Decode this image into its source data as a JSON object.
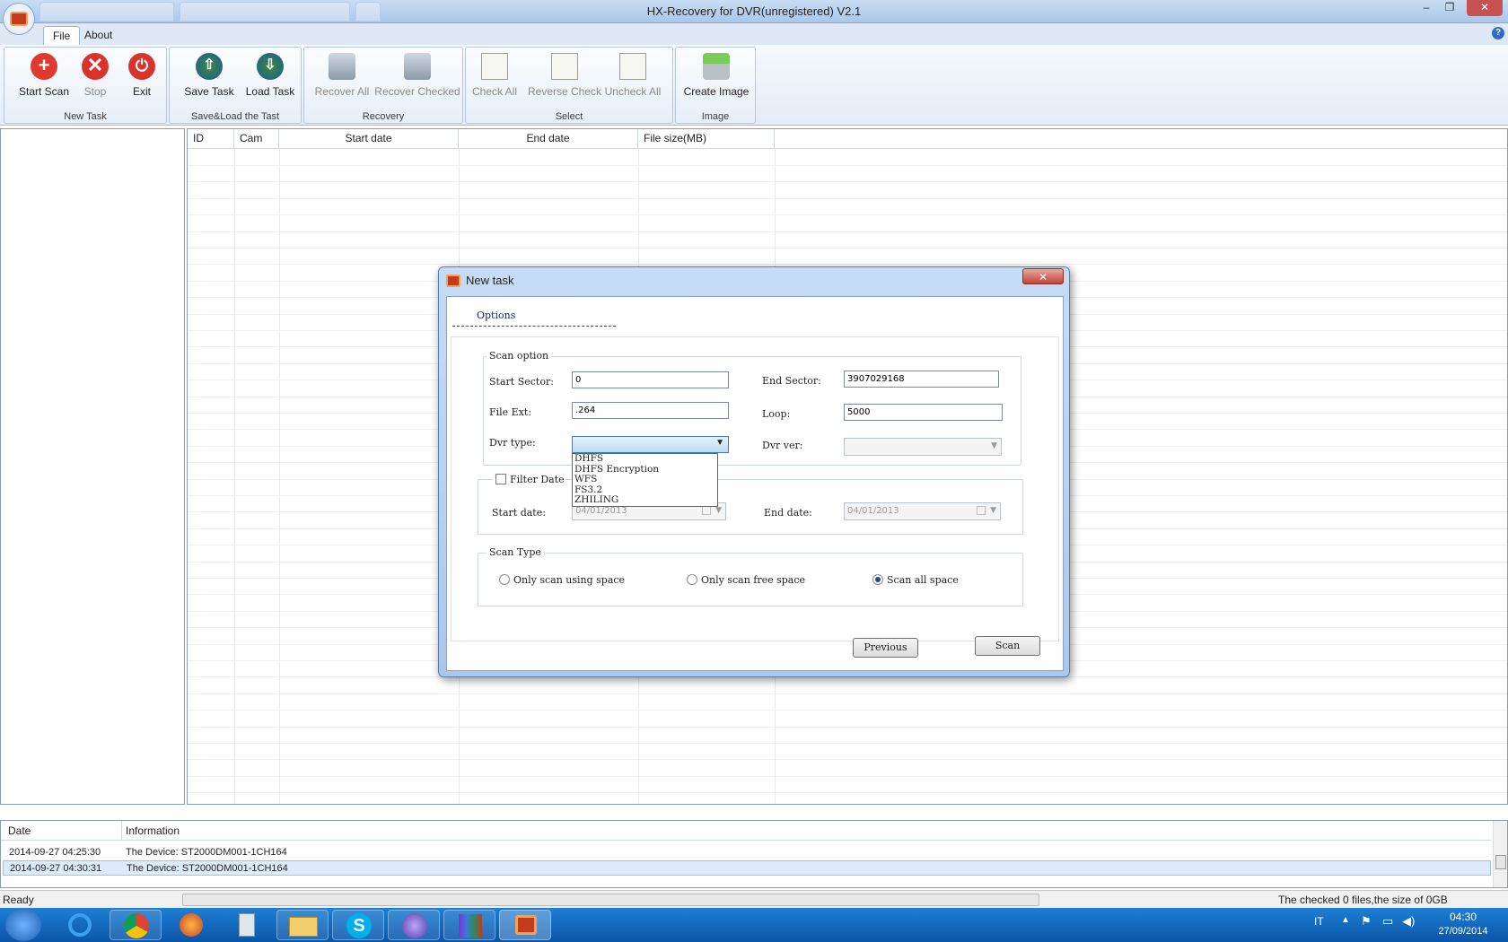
{
  "window": {
    "title": "HX-Recovery for DVR(unregistered) V2.1",
    "min": "–",
    "restore": "❐",
    "close": "✕"
  },
  "ribbon_tabs": [
    {
      "label": "File"
    },
    {
      "label": "About"
    }
  ],
  "help": "?",
  "ribbon": {
    "groups": [
      {
        "label": "New Task",
        "buttons": [
          {
            "label": "Start Scan",
            "icon": "plus-icon"
          },
          {
            "label": "Stop",
            "icon": "x-icon"
          },
          {
            "label": "Exit",
            "icon": "power-icon"
          }
        ]
      },
      {
        "label": "Save&Load the Tast",
        "buttons": [
          {
            "label": "Save Task",
            "icon": "save-icon"
          },
          {
            "label": "Load Task",
            "icon": "load-icon"
          }
        ]
      },
      {
        "label": "Recovery",
        "buttons": [
          {
            "label": "Recover All",
            "icon": "recover-icon"
          },
          {
            "label": "Recover Checked",
            "icon": "recover-checked-icon"
          }
        ]
      },
      {
        "label": "Select",
        "buttons": [
          {
            "label": "Check All",
            "icon": "checklist-icon"
          },
          {
            "label": "Reverse Check",
            "icon": "checklist-icon"
          },
          {
            "label": "Uncheck All",
            "icon": "checklist-icon"
          }
        ]
      },
      {
        "label": "Image",
        "buttons": [
          {
            "label": "Create Image",
            "icon": "disk-image-icon"
          }
        ]
      }
    ]
  },
  "table": {
    "columns": [
      "ID",
      "Cam",
      "Start date",
      "End date",
      "File size(MB)"
    ]
  },
  "log": {
    "columns": [
      "Date",
      "Information"
    ],
    "rows": [
      {
        "date": "2014-09-27 04:25:30",
        "info": "The Device: ST2000DM001-1CH164"
      },
      {
        "date": "2014-09-27 04:30:31",
        "info": "The Device: ST2000DM001-1CH164"
      }
    ]
  },
  "status": {
    "left": "Ready",
    "right": "The checked 0 files,the size of 0GB"
  },
  "taskbar": {
    "lang": "IT",
    "time": "04:30",
    "date": "27/09/2014"
  },
  "dialog": {
    "title": "New task",
    "close": "✕",
    "tab": "Options",
    "scan_option": {
      "legend": "Scan option",
      "start_sector_label": "Start Sector:",
      "start_sector": "0",
      "end_sector_label": "End Sector:",
      "end_sector": "3907029168",
      "file_ext_label": "File Ext:",
      "file_ext": ".264",
      "loop_label": "Loop:",
      "loop": "5000",
      "dvr_type_label": "Dvr type:",
      "dvr_type_value": "",
      "dvr_type_options": [
        "DHFS",
        "DHFS Encryption",
        "WFS",
        "FS3.2",
        "ZHILING"
      ],
      "dvr_ver_label": "Dvr ver:"
    },
    "filter": {
      "label": "Filter Date",
      "start_label": "Start date:",
      "start_value": "04/01/2013",
      "end_label": "End date:",
      "end_value": "04/01/2013"
    },
    "scan_type": {
      "legend": "Scan Type",
      "options": [
        "Only scan using space",
        "Only scan free space",
        "Scan all space"
      ],
      "selected": "Scan all space"
    },
    "previous": "Previous",
    "scan": "Scan"
  }
}
